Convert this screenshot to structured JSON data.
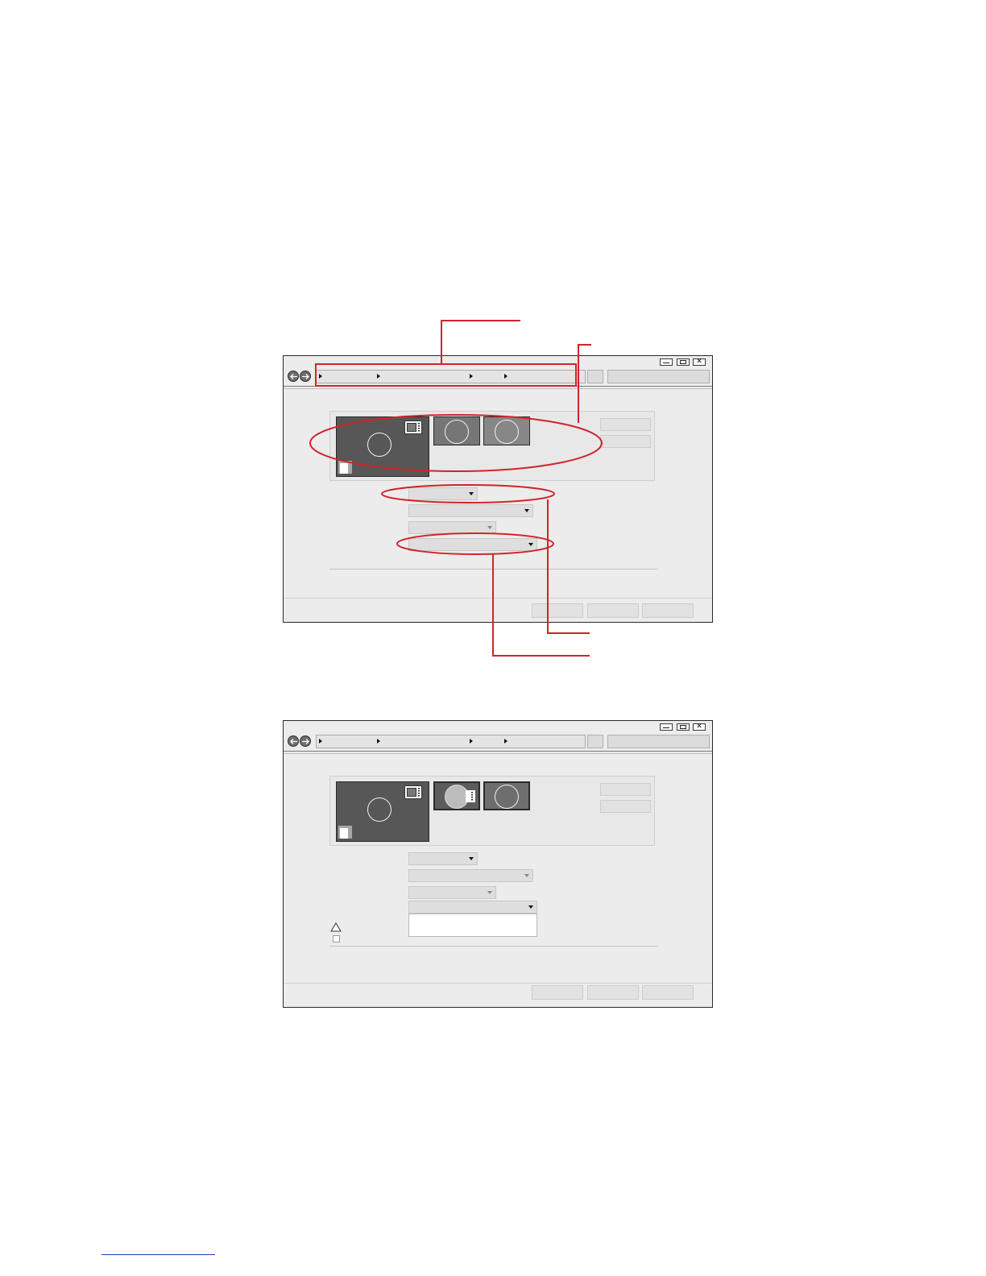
{
  "colors": {
    "callout_red": "#d2232a",
    "window_bg": "#ececec",
    "monitor_primary": "#575757",
    "footer_link": "#2040c8"
  },
  "icons": {
    "back": "arrow-left-icon",
    "forward": "arrow-right-icon",
    "minimize": "minimize-icon",
    "maximize": "maximize-icon",
    "close": "close-icon",
    "warning": "warning-triangle-icon",
    "checkbox": "checkbox-icon",
    "identify": "monitor-identify-icon"
  },
  "windows": [
    {
      "breadcrumb_segments": 4,
      "dropdowns": 4,
      "dropdown_open": false,
      "footer_buttons": 3
    },
    {
      "breadcrumb_segments": 4,
      "dropdowns": 4,
      "dropdown_open": true,
      "footer_buttons": 3
    }
  ]
}
